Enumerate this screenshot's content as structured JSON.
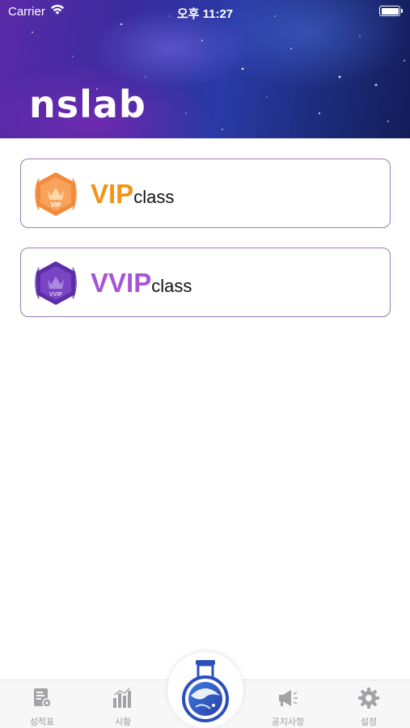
{
  "status_bar": {
    "carrier": "Carrier",
    "time": "오후 11:27"
  },
  "header": {
    "logo_text": "nslab"
  },
  "classes": [
    {
      "badge_text": "VIP",
      "title": "VIP",
      "suffix": "class",
      "color": "#f29418",
      "badge_icon": "vip-crown-badge-icon"
    },
    {
      "badge_text": "VVIP",
      "title": "VVIP",
      "suffix": "class",
      "color": "#a755d6",
      "badge_icon": "vvip-crown-badge-icon"
    }
  ],
  "tabbar": {
    "tabs": [
      {
        "label": "성적표",
        "icon": "report-card-icon"
      },
      {
        "label": "시황",
        "icon": "bar-chart-icon"
      },
      {
        "label": "",
        "icon": "flask-globe-icon"
      },
      {
        "label": "공지사항",
        "icon": "megaphone-icon"
      },
      {
        "label": "설정",
        "icon": "gear-icon"
      }
    ]
  },
  "colors": {
    "vip": "#f29418",
    "vvip": "#a755d6",
    "card_border": "#9b7bb4",
    "tab_inactive": "#9a9a9e"
  }
}
